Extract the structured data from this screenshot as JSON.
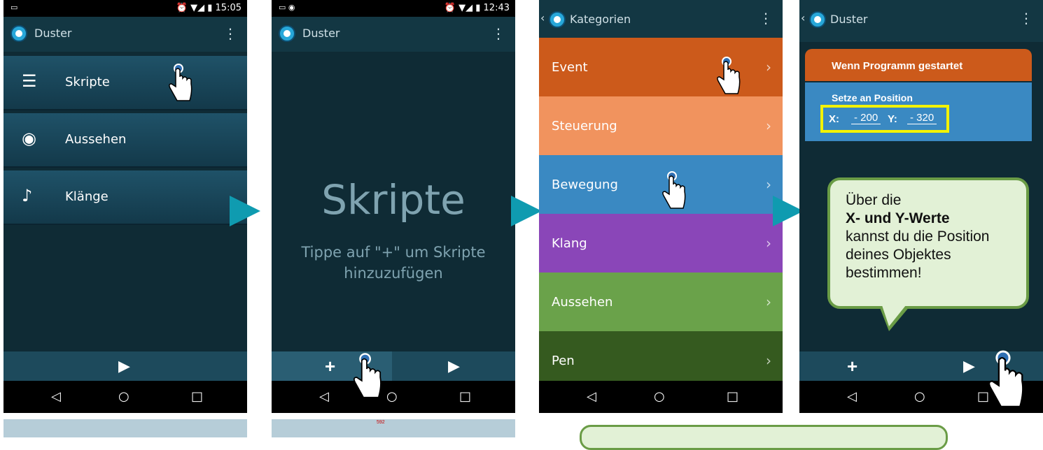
{
  "screen1": {
    "status_time": "15:05",
    "app_title": "Duster",
    "items": [
      {
        "label": "Skripte",
        "icon": "script-list-icon"
      },
      {
        "label": "Aussehen",
        "icon": "eye-icon"
      },
      {
        "label": "Klänge",
        "icon": "ear-sound-icon"
      }
    ],
    "play_symbol": "▶"
  },
  "screen2": {
    "status_time": "12:43",
    "app_title": "Duster",
    "empty_title": "Skripte",
    "empty_hint": "Tippe auf \"+\" um Skripte hinzuzufügen",
    "add_symbol": "+",
    "play_symbol": "▶"
  },
  "screen3": {
    "app_title": "Kategorien",
    "categories": [
      {
        "label": "Event",
        "color": "#cc5a1b"
      },
      {
        "label": "Steuerung",
        "color": "#f1935e"
      },
      {
        "label": "Bewegung",
        "color": "#3a89c2"
      },
      {
        "label": "Klang",
        "color": "#8a46b8"
      },
      {
        "label": "Aussehen",
        "color": "#6aa24a"
      },
      {
        "label": "Pen",
        "color": "#355a1f"
      }
    ]
  },
  "screen4": {
    "app_title": "Duster",
    "when_block": "Wenn Programm gestartet",
    "set_block": "Setze an Position",
    "x_label": "X:",
    "x_value": "- 200",
    "y_label": "Y:",
    "y_value": "- 320",
    "add_symbol": "+",
    "play_symbol": "▶"
  },
  "callout": {
    "line1": "Über die",
    "bold": "X- und Y-Werte",
    "line3": "kannst du die Position deines Objektes bestimmen!"
  },
  "nav": {
    "back": "◁",
    "home": "○",
    "recents": "□"
  },
  "thumb_label": "592"
}
